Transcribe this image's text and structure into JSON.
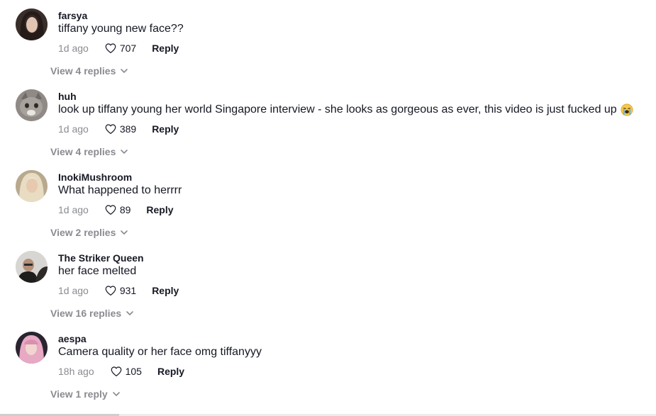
{
  "comments": [
    {
      "username": "farsya",
      "text": "tiffany young new face??",
      "time": "1d ago",
      "likes": "707",
      "reply_label": "Reply",
      "view_replies": "View 4 replies",
      "avatar": "avatar-dark-hair"
    },
    {
      "username": "huh",
      "text": "look up tiffany young her world Singapore interview - she looks as gorgeous as ever, this video is just fucked up",
      "emoji": "loudly-crying-face-emoji",
      "time": "1d ago",
      "likes": "389",
      "reply_label": "Reply",
      "view_replies": "View 4 replies",
      "avatar": "avatar-cat"
    },
    {
      "username": "InokiMushroom",
      "text": "What happened to herrrr",
      "time": "1d ago",
      "likes": "89",
      "reply_label": "Reply",
      "view_replies": "View 2 replies",
      "avatar": "avatar-blonde"
    },
    {
      "username": "The Striker Queen",
      "text": "her face melted",
      "time": "1d ago",
      "likes": "931",
      "reply_label": "Reply",
      "view_replies": "View 16 replies",
      "avatar": "avatar-person-dark"
    },
    {
      "username": "aespa",
      "text": "Camera quality or her face omg tiffanyyy",
      "time": "18h ago",
      "likes": "105",
      "reply_label": "Reply",
      "view_replies": "View 1 reply",
      "avatar": "avatar-pink-hair"
    }
  ],
  "colors": {
    "text_primary": "#161823",
    "text_secondary": "#8a8b91",
    "background": "#ffffff"
  }
}
